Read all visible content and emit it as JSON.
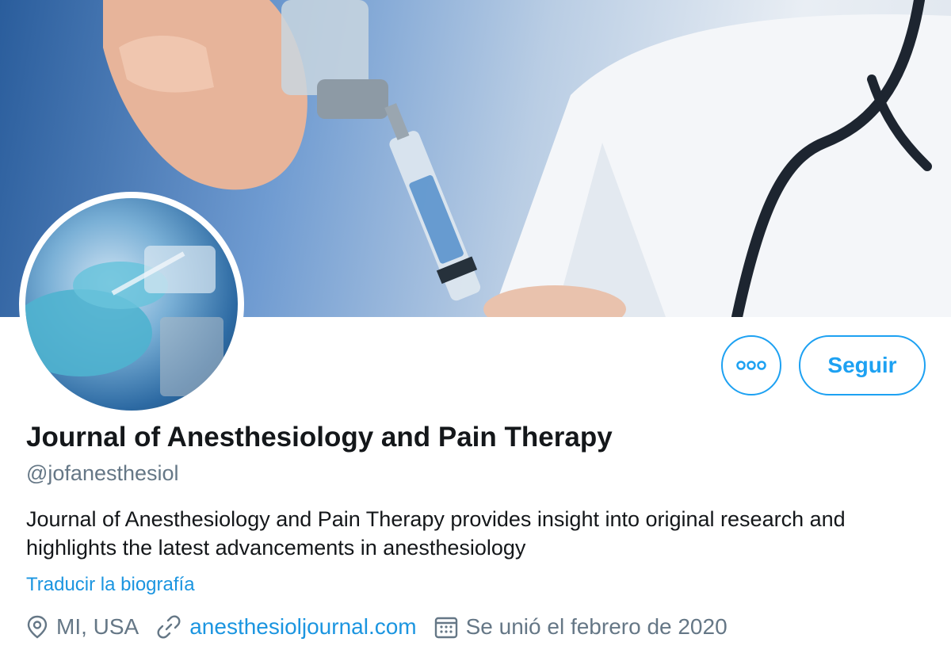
{
  "profile": {
    "name": "Journal of Anesthesiology and Pain Therapy",
    "handle": "@jofanesthesiol",
    "bio": "Journal of Anesthesiology and Pain Therapy provides insight into original research and highlights the latest advancements in anesthesiology",
    "translate_label": "Traducir la biografía",
    "location": "MI, USA",
    "website": "anesthesioljournal.com",
    "joined": "Se unió el febrero de 2020"
  },
  "actions": {
    "follow_label": "Seguir",
    "more_icon": "more-dots-icon"
  },
  "icons": {
    "location": "location-pin-icon",
    "link": "link-icon",
    "calendar": "calendar-icon"
  },
  "colors": {
    "accent": "#1da1f2",
    "link": "#1b95e0",
    "secondary_text": "#657786",
    "primary_text": "#14171a"
  }
}
